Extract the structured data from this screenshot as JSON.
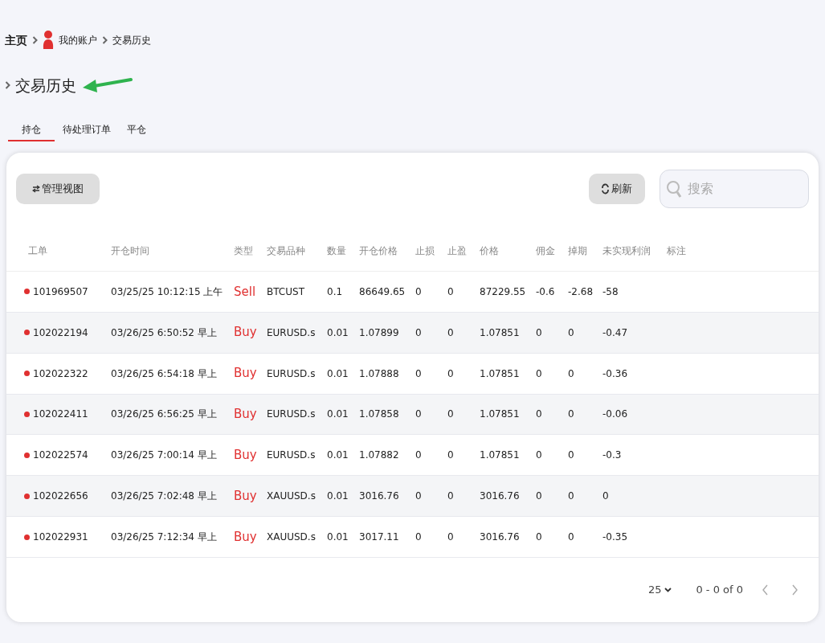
{
  "breadcrumb": [
    {
      "label": "主页",
      "kind": "text"
    },
    {
      "label": "我的账户",
      "kind": "user"
    },
    {
      "label": "交易历史",
      "kind": "text"
    }
  ],
  "page_title": "交易历史",
  "tabs": [
    {
      "label": "持仓",
      "selected": true
    },
    {
      "label": "待处理订单",
      "selected": false
    },
    {
      "label": "平仓",
      "selected": false
    }
  ],
  "toolbar": {
    "manage_view": "管理视图",
    "refresh": "刷新",
    "search": {
      "placeholder": "搜索"
    }
  },
  "table": {
    "columns": [
      "工单",
      "开仓时间",
      "类型",
      "交易品种",
      "数量",
      "开仓价格",
      "止损",
      "止盈",
      "价格",
      "佣金",
      "掉期",
      "未实现利润",
      "标注"
    ],
    "rows": [
      [
        "101969507",
        "03/25/25 10:12:15 上午",
        "Sell",
        "BTCUST",
        "0.1",
        "86649.65",
        "0",
        "0",
        "87229.55",
        "-0.6",
        "-2.68",
        "-58"
      ],
      [
        "102022194",
        "03/26/25 6:50:52 早上",
        "Buy",
        "EURUSD.s",
        "0.01",
        "1.07899",
        "0",
        "0",
        "1.07851",
        "0",
        "0",
        "-0.47"
      ],
      [
        "102022322",
        "03/26/25 6:54:18 早上",
        "Buy",
        "EURUSD.s",
        "0.01",
        "1.07888",
        "0",
        "0",
        "1.07851",
        "0",
        "0",
        "-0.36"
      ],
      [
        "102022411",
        "03/26/25 6:56:25 早上",
        "Buy",
        "EURUSD.s",
        "0.01",
        "1.07858",
        "0",
        "0",
        "1.07851",
        "0",
        "0",
        "-0.06"
      ],
      [
        "102022574",
        "03/26/25 7:00:14 早上",
        "Buy",
        "EURUSD.s",
        "0.01",
        "1.07882",
        "0",
        "0",
        "1.07851",
        "0",
        "0",
        "-0.3"
      ],
      [
        "102022656",
        "03/26/25 7:02:48 早上",
        "Buy",
        "XAUUSD.s",
        "0.01",
        "3016.76",
        "0",
        "0",
        "3016.76",
        "0",
        "0",
        "0"
      ],
      [
        "102022931",
        "03/26/25 7:12:34 早上",
        "Buy",
        "XAUUSD.s",
        "0.01",
        "3017.11",
        "0",
        "0",
        "3016.76",
        "0",
        "0",
        "-0.35"
      ]
    ]
  },
  "pagination": {
    "page_size": "25",
    "range": "0 - 0 of 0"
  }
}
